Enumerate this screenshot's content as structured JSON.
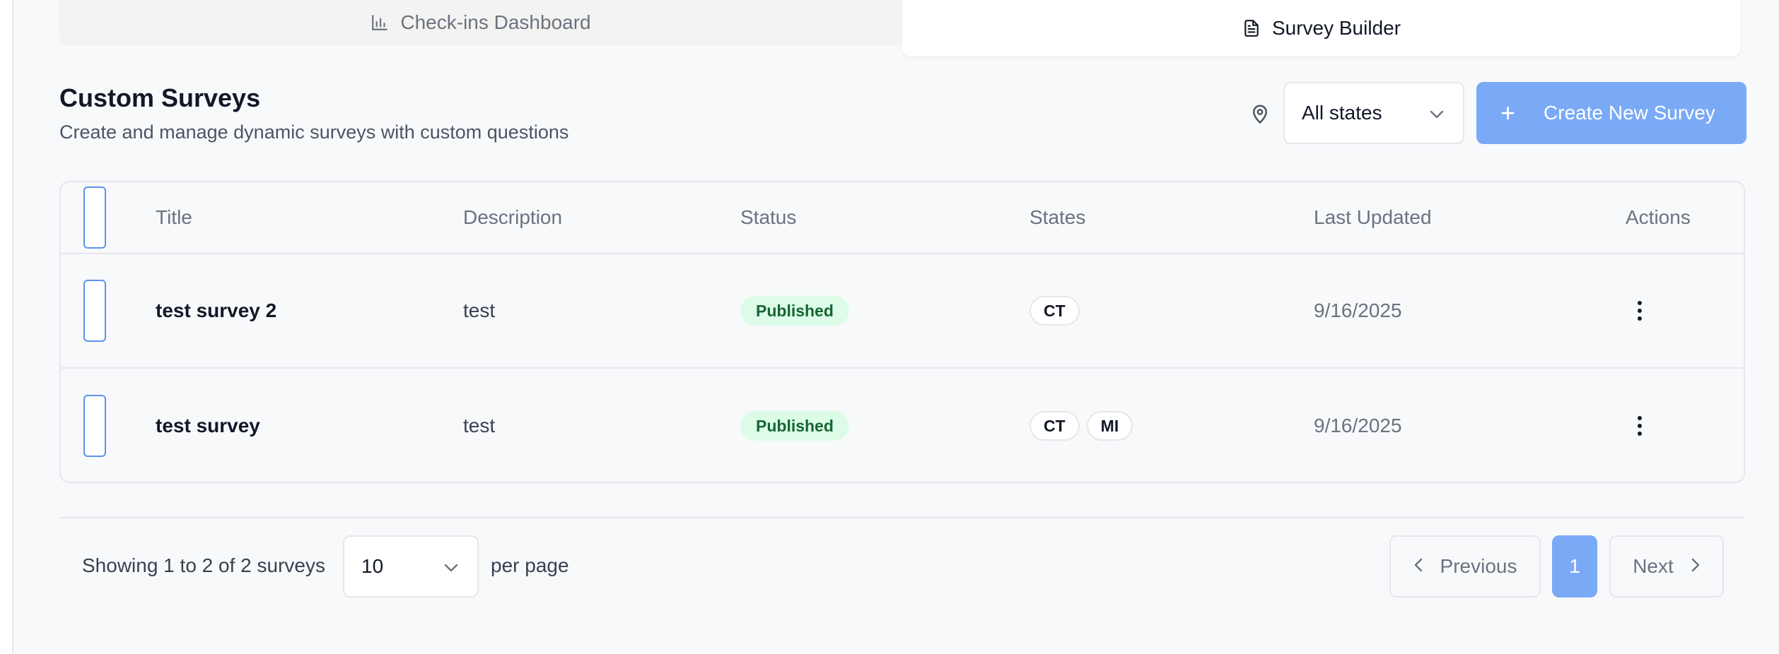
{
  "tabs": [
    {
      "label": "Check-ins Dashboard",
      "icon": "bar-chart-icon",
      "active": false
    },
    {
      "label": "Survey Builder",
      "icon": "document-icon",
      "active": true
    }
  ],
  "header": {
    "title": "Custom Surveys",
    "subtitle": "Create and manage dynamic surveys with custom questions",
    "state_filter": {
      "icon": "map-pin-icon",
      "value": "All states"
    },
    "create_button": {
      "icon": "plus-icon",
      "label": "Create New Survey"
    }
  },
  "table": {
    "columns": [
      "Title",
      "Description",
      "Status",
      "States",
      "Last Updated",
      "Actions"
    ],
    "rows": [
      {
        "title": "test survey 2",
        "description": "test",
        "status": "Published",
        "states": [
          "CT"
        ],
        "last_updated": "9/16/2025"
      },
      {
        "title": "test survey",
        "description": "test",
        "status": "Published",
        "states": [
          "CT",
          "MI"
        ],
        "last_updated": "9/16/2025"
      }
    ]
  },
  "pagination": {
    "showing_text": "Showing 1 to 2 of 2 surveys",
    "per_page_value": "10",
    "per_page_label": "per page",
    "previous_label": "Previous",
    "current_page": "1",
    "next_label": "Next"
  },
  "colors": {
    "accent": "#7aaaf6",
    "badge_bg": "#dcfce7",
    "badge_text": "#166534",
    "checkbox_border": "#5b93ec"
  }
}
